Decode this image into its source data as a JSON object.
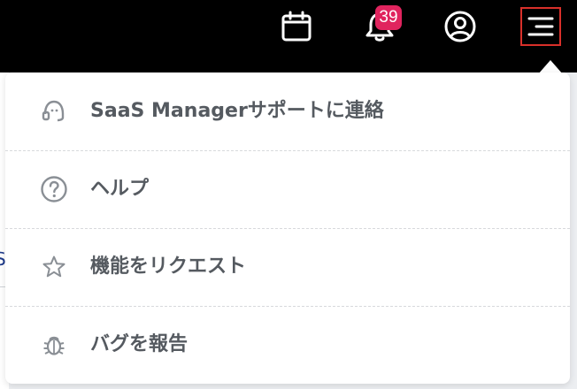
{
  "header": {
    "icons": {
      "calendar": "calendar-icon",
      "notifications": "bell-icon",
      "account": "user-circle-icon",
      "menu": "hamburger-menu-icon"
    },
    "notification_count": "39"
  },
  "menu": {
    "items": [
      {
        "label": "SaaS Managerサポートに連絡",
        "icon": "headset-support-icon"
      },
      {
        "label": "ヘルプ",
        "icon": "question-circle-icon"
      },
      {
        "label": "機能をリクエスト",
        "icon": "star-icon"
      },
      {
        "label": "バグを報告",
        "icon": "bug-icon"
      }
    ]
  },
  "colors": {
    "topbar": "#000000",
    "badge": "#e0245e",
    "menu_highlight": "#d9302a",
    "text": "#555a60",
    "icon": "#8a8f95"
  }
}
